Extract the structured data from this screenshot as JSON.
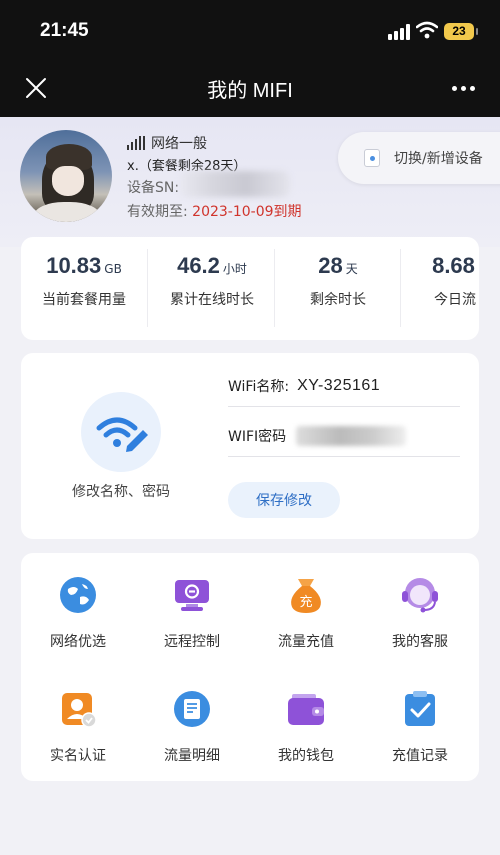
{
  "status_bar": {
    "time": "21:45",
    "battery": "23"
  },
  "nav": {
    "title": "我的 MIFI"
  },
  "device": {
    "network_status": "网络一般",
    "plan": "x.（套餐剩余28天）",
    "sn_label": "设备SN:",
    "expire_label": "有效期至:",
    "expire_date": "2023-10-09到期",
    "switch_label": "切换/新增设备"
  },
  "stats": [
    {
      "value": "10.83",
      "unit": "GB",
      "label": "当前套餐用量"
    },
    {
      "value": "46.2",
      "unit": "小时",
      "label": "累计在线时长"
    },
    {
      "value": "28",
      "unit": "天",
      "label": "剩余时长"
    },
    {
      "value": "8.68",
      "unit": "",
      "label": "今日流"
    }
  ],
  "wifi": {
    "edit_label": "修改名称、密码",
    "name_label": "WiFi名称:",
    "name_value": "XY-325161",
    "password_label": "WIFI密码",
    "save_label": "保存修改"
  },
  "menu": [
    {
      "icon": "globe-icon",
      "label": "网络优选",
      "color": "#3b8de0"
    },
    {
      "icon": "remote-control-icon",
      "label": "远程控制",
      "color": "#8e52d8"
    },
    {
      "icon": "money-bag-icon",
      "label": "流量充值",
      "color": "#f08a24"
    },
    {
      "icon": "customer-service-icon",
      "label": "我的客服",
      "color": "#9a5ad6"
    },
    {
      "icon": "id-verify-icon",
      "label": "实名认证",
      "color": "#f08a24"
    },
    {
      "icon": "usage-detail-icon",
      "label": "流量明细",
      "color": "#3b8de0"
    },
    {
      "icon": "wallet-icon",
      "label": "我的钱包",
      "color": "#8e52d8"
    },
    {
      "icon": "recharge-record-icon",
      "label": "充值记录",
      "color": "#3b8de0"
    }
  ],
  "menu_badge": "充"
}
